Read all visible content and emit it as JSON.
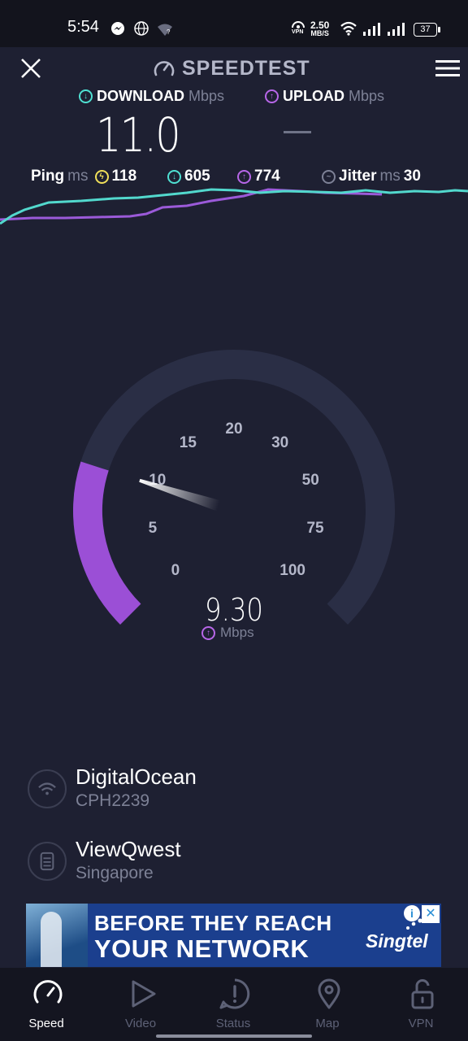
{
  "status_bar": {
    "time": "5:54",
    "net_speed_value": "2.50",
    "net_speed_unit": "MB/S",
    "vpn": "VPN",
    "battery": "37"
  },
  "header": {
    "brand": "SPEEDTEST"
  },
  "download": {
    "label": "DOWNLOAD",
    "unit": "Mbps",
    "value": "11.0",
    "color": "#4fe0d2"
  },
  "upload": {
    "label": "UPLOAD",
    "unit": "Mbps",
    "value": "—",
    "color": "#b766e8"
  },
  "stats": {
    "ping_label": "Ping",
    "ping_unit": "ms",
    "idle_ping": "118",
    "download_ping": "605",
    "upload_ping": "774",
    "jitter_label": "Jitter",
    "jitter_unit": "ms",
    "jitter": "30"
  },
  "gauge": {
    "scale_labels": [
      "0",
      "5",
      "10",
      "15",
      "20",
      "30",
      "50",
      "75",
      "100"
    ],
    "current_value": "9.30",
    "unit": "Mbps",
    "fill_color": "#9b4fd6",
    "track_color": "#2a2e45"
  },
  "server": {
    "host": "DigitalOcean",
    "device": "CPH2239"
  },
  "isp": {
    "name": "ViewQwest",
    "location": "Singapore"
  },
  "ad": {
    "line1": "BEFORE THEY REACH",
    "line2": "YOUR NETWORK",
    "brand": "Singtel",
    "info": "i",
    "close": "✕"
  },
  "nav": [
    {
      "label": "Speed",
      "icon": "speedometer-icon",
      "active": true
    },
    {
      "label": "Video",
      "icon": "play-icon",
      "active": false
    },
    {
      "label": "Status",
      "icon": "alert-icon",
      "active": false
    },
    {
      "label": "Map",
      "icon": "map-pin-icon",
      "active": false
    },
    {
      "label": "VPN",
      "icon": "lock-icon",
      "active": false
    }
  ]
}
